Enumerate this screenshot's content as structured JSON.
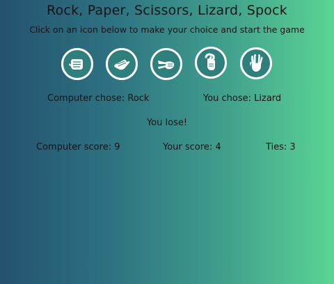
{
  "header": {
    "title": "Rock, Paper, Scissors, Lizard, Spock",
    "instructions": "Click on an icon below to make your choice and start the game"
  },
  "choices": [
    {
      "name": "Rock",
      "icon": "rock-fist-icon"
    },
    {
      "name": "Paper",
      "icon": "paper-hand-icon"
    },
    {
      "name": "Scissors",
      "icon": "scissors-hand-icon"
    },
    {
      "name": "Lizard",
      "icon": "lizard-hand-icon"
    },
    {
      "name": "Spock",
      "icon": "spock-hand-icon"
    }
  ],
  "results": {
    "computer_choice": "Computer chose: Rock",
    "player_choice": "You chose: Lizard",
    "outcome": "You lose!"
  },
  "scores": {
    "computer": "Computer score: 9",
    "player": "Your score: 4",
    "ties": "Ties: 3"
  },
  "colors": {
    "icon_fill": "#2f7f7d",
    "icon_stroke": "#ffffff",
    "text": "#0e1317"
  }
}
